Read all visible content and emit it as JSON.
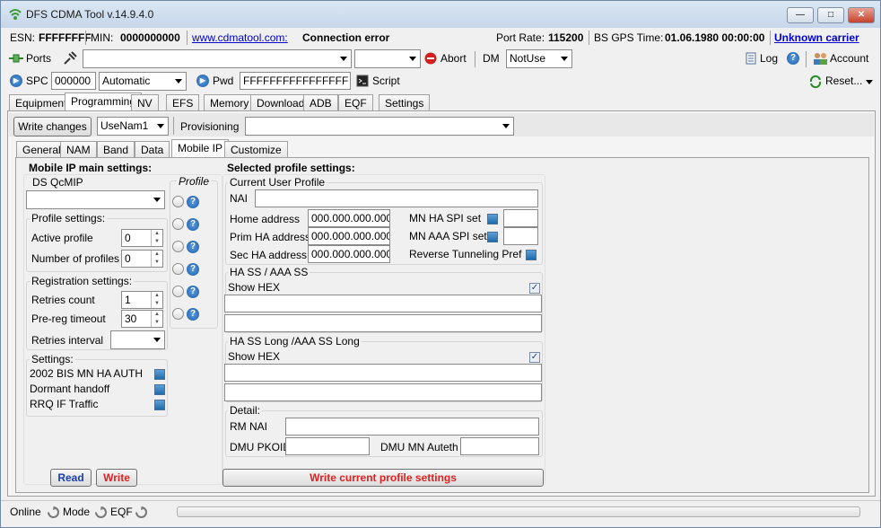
{
  "window": {
    "title": "DFS CDMA Tool v.14.9.4.0"
  },
  "info": {
    "esn_label": "ESN:",
    "esn_value": "FFFFFFFF",
    "min_label": "MIN:",
    "min_value": "0000000000",
    "site_link": "www.cdmatool.com:",
    "connection_status": "Connection error",
    "port_rate_label": "Port Rate:",
    "port_rate_value": "115200",
    "bs_gps_label": "BS GPS Time:",
    "bs_gps_value": "01.06.1980 00:00:00",
    "carrier_link": "Unknown carrier"
  },
  "toolbar1": {
    "ports_label": "Ports",
    "abort_label": "Abort",
    "dm_label": "DM",
    "dm_value": "NotUse",
    "log_label": "Log",
    "account_label": "Account"
  },
  "toolbar2": {
    "spc_label": "SPC",
    "spc_value": "000000",
    "mode_value": "Automatic",
    "pwd_label": "Pwd",
    "pwd_value": "FFFFFFFFFFFFFFFF",
    "script_label": "Script",
    "reset_label": "Reset..."
  },
  "main_tabs": [
    "Equipment",
    "Programming",
    "NV",
    "EFS",
    "Memory",
    "Download",
    "ADB",
    "EQF",
    "Settings"
  ],
  "programming": {
    "write_changes": "Write changes",
    "nam_value": "UseNam1",
    "provisioning_label": "Provisioning"
  },
  "sub_tabs": [
    "General",
    "NAM",
    "Band",
    "Data",
    "Mobile IP",
    "Customize"
  ],
  "mip": {
    "main_title": "Mobile IP main settings:",
    "ds_qcmip": "DS QcMIP",
    "profile_col": "Profile",
    "profile_settings": "Profile settings:",
    "active_profile_label": "Active profile",
    "active_profile_value": "0",
    "num_profiles_label": "Number of profiles",
    "num_profiles_value": "0",
    "registration_settings": "Registration settings:",
    "retries_count_label": "Retries count",
    "retries_count_value": "1",
    "prereg_timeout_label": "Pre-reg timeout",
    "prereg_timeout_value": "30",
    "retries_interval_label": "Retries interval",
    "settings": "Settings:",
    "bis_auth": "2002 BIS MN HA AUTH",
    "dormant_handoff": "Dormant handoff",
    "rrq_traffic": "RRQ IF Traffic",
    "read": "Read",
    "write": "Write"
  },
  "profile": {
    "title": "Selected profile settings:",
    "current_user_profile": "Current User Profile",
    "nai_label": "NAI",
    "home_address_label": "Home address",
    "home_address_value": "000.000.000.000",
    "prim_ha_label": "Prim HA address",
    "prim_ha_value": "000.000.000.000",
    "sec_ha_label": "Sec HA address",
    "sec_ha_value": "000.000.000.000",
    "mn_ha_spi_label": "MN HA SPI set",
    "mn_aaa_spi_label": "MN AAA SPI set",
    "reverse_tunneling_label": "Reverse Tunneling Pref",
    "ha_ss_group": "HA SS / AAA SS",
    "show_hex": "Show HEX",
    "ha_ss_long_group": "HA SS Long /AAA SS Long",
    "detail": "Detail:",
    "rm_nai_label": "RM NAI",
    "dmu_pkoid_label": "DMU PKOID",
    "dmu_mn_auth_label": "DMU MN Auteth",
    "write_profile": "Write current profile settings"
  },
  "status": {
    "online": "Online",
    "mode": "Mode",
    "eqf": "EQF"
  }
}
